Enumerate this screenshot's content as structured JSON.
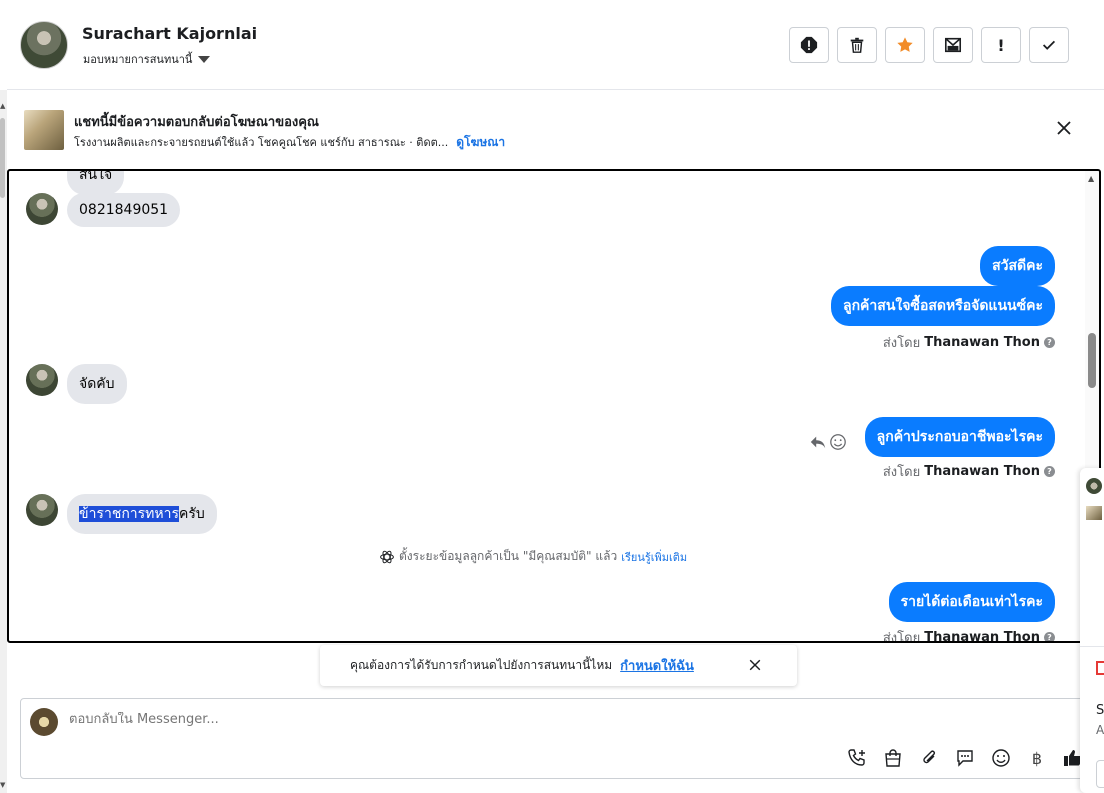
{
  "header": {
    "contact_name": "Surachart Kajornlai",
    "assign_label": "มอบหมายการสนทนานี้",
    "actions": [
      {
        "name": "report-icon",
        "label": "!"
      },
      {
        "name": "trash-icon",
        "label": ""
      },
      {
        "name": "star-icon",
        "label": ""
      },
      {
        "name": "mark-unread-icon",
        "label": ""
      },
      {
        "name": "follow-up-icon",
        "label": "!"
      },
      {
        "name": "check-icon",
        "label": ""
      }
    ]
  },
  "ad": {
    "title": "แชทนี้มีข้อความตอบกลับต่อโฆษณาของคุณ",
    "description": "โรงงานผลิตและกระจายรถยนต์ใช้แล้ว โชคคูณโชค แชร์กับ สาธารณะ · ติดต...",
    "link": "ดูโฆษณา"
  },
  "chat": {
    "partial_top": "สนใจ",
    "incoming_1": "0821849051",
    "outgoing_1": "สวัสดีคะ",
    "outgoing_2": "ลูกค้าสนใจซื้อสดหรือจัดแนนซ์คะ",
    "sent_by_prefix": "ส่งโดย",
    "sender": "Thanawan Thon",
    "incoming_2": "จัดคับ",
    "outgoing_3": "ลูกค้าประกอบอาชีพอะไรคะ",
    "incoming_3_highlight": "ข้าราชการทหาร",
    "incoming_3_rest": "ครับ",
    "system_text": "ตั้งระยะข้อมูลลูกค้าเป็น \"มีคุณสมบัติ\" แล้ว",
    "system_link": "เรียนรู้เพิ่มเติม",
    "outgoing_4": "รายได้ต่อเดือนเท่าไรคะ"
  },
  "reminder": {
    "text": "คุณต้องการได้รับการกำหนดไปยังการสนทนานี้ไหม",
    "link": "กำหนดให้ฉัน"
  },
  "composer": {
    "placeholder": "ตอบกลับใน Messenger...",
    "tools": [
      "phone-plus-icon",
      "shopping-bag-icon",
      "paperclip-icon",
      "saved-reply-icon",
      "emoji-icon",
      "baht-icon",
      "thumbs-up-icon"
    ],
    "baht_symbol": "฿"
  },
  "side_peek": {
    "s_letter": "S",
    "a_letter": "A"
  },
  "colors": {
    "outgoing_bubble": "#0a7cff",
    "incoming_bubble": "#e4e6eb",
    "link": "#1b74e4",
    "star": "#f28c28"
  }
}
